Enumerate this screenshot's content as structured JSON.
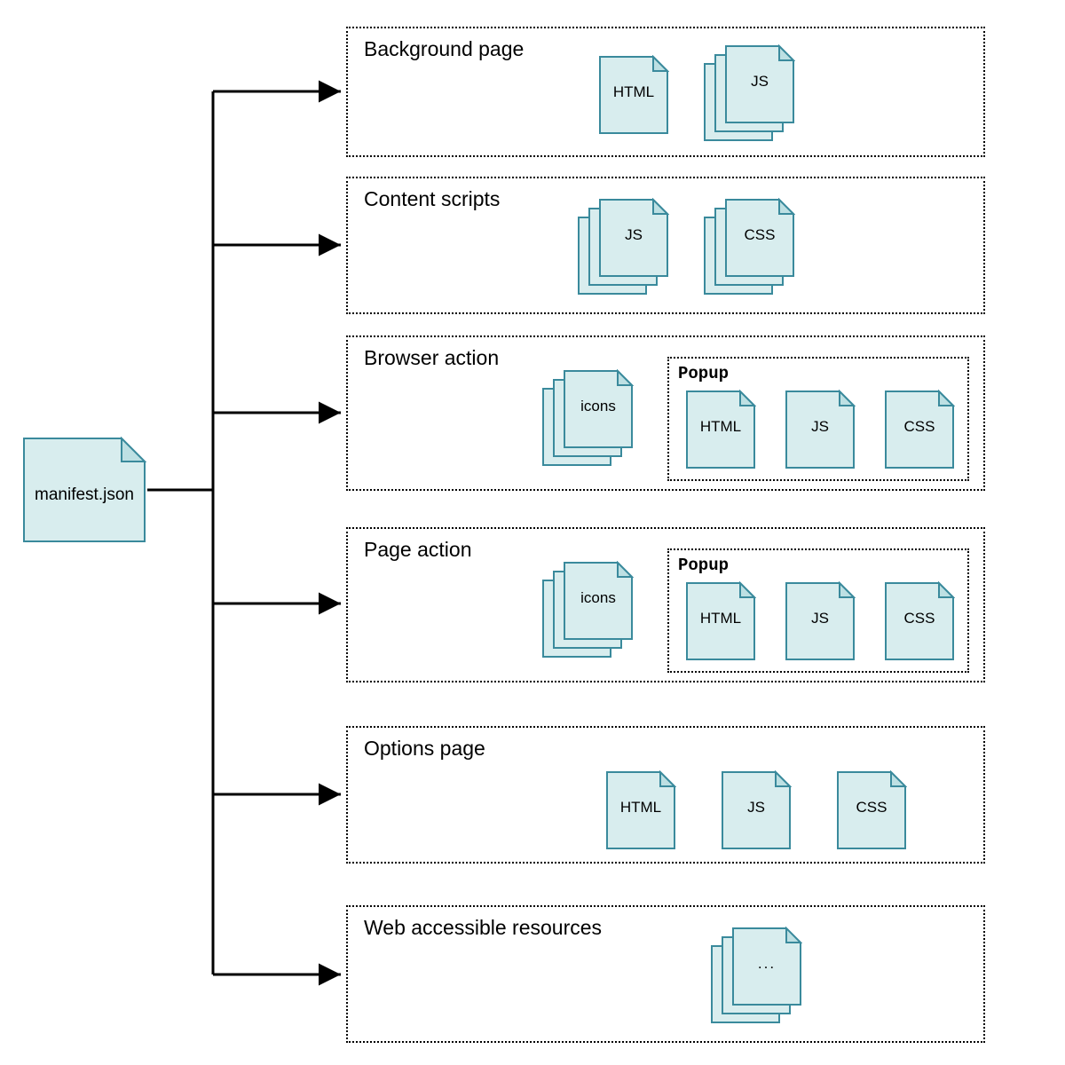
{
  "manifest": {
    "label": "manifest.json"
  },
  "boxes": {
    "bg": {
      "title": "Background page",
      "files": [
        "HTML",
        "JS"
      ]
    },
    "cs": {
      "title": "Content scripts",
      "files": [
        "JS",
        "CSS"
      ]
    },
    "ba": {
      "title": "Browser action",
      "icons_label": "icons",
      "popup_title": "Popup",
      "popup_files": [
        "HTML",
        "JS",
        "CSS"
      ]
    },
    "pa": {
      "title": "Page action",
      "icons_label": "icons",
      "popup_title": "Popup",
      "popup_files": [
        "HTML",
        "JS",
        "CSS"
      ]
    },
    "opt": {
      "title": "Options page",
      "files": [
        "HTML",
        "JS",
        "CSS"
      ]
    },
    "war": {
      "title": "Web accessible resources",
      "file_label": "..."
    }
  },
  "colors": {
    "file_fill": "#d8edee",
    "file_stroke": "#3a8a9c",
    "fold_fill": "#bde0e3"
  }
}
